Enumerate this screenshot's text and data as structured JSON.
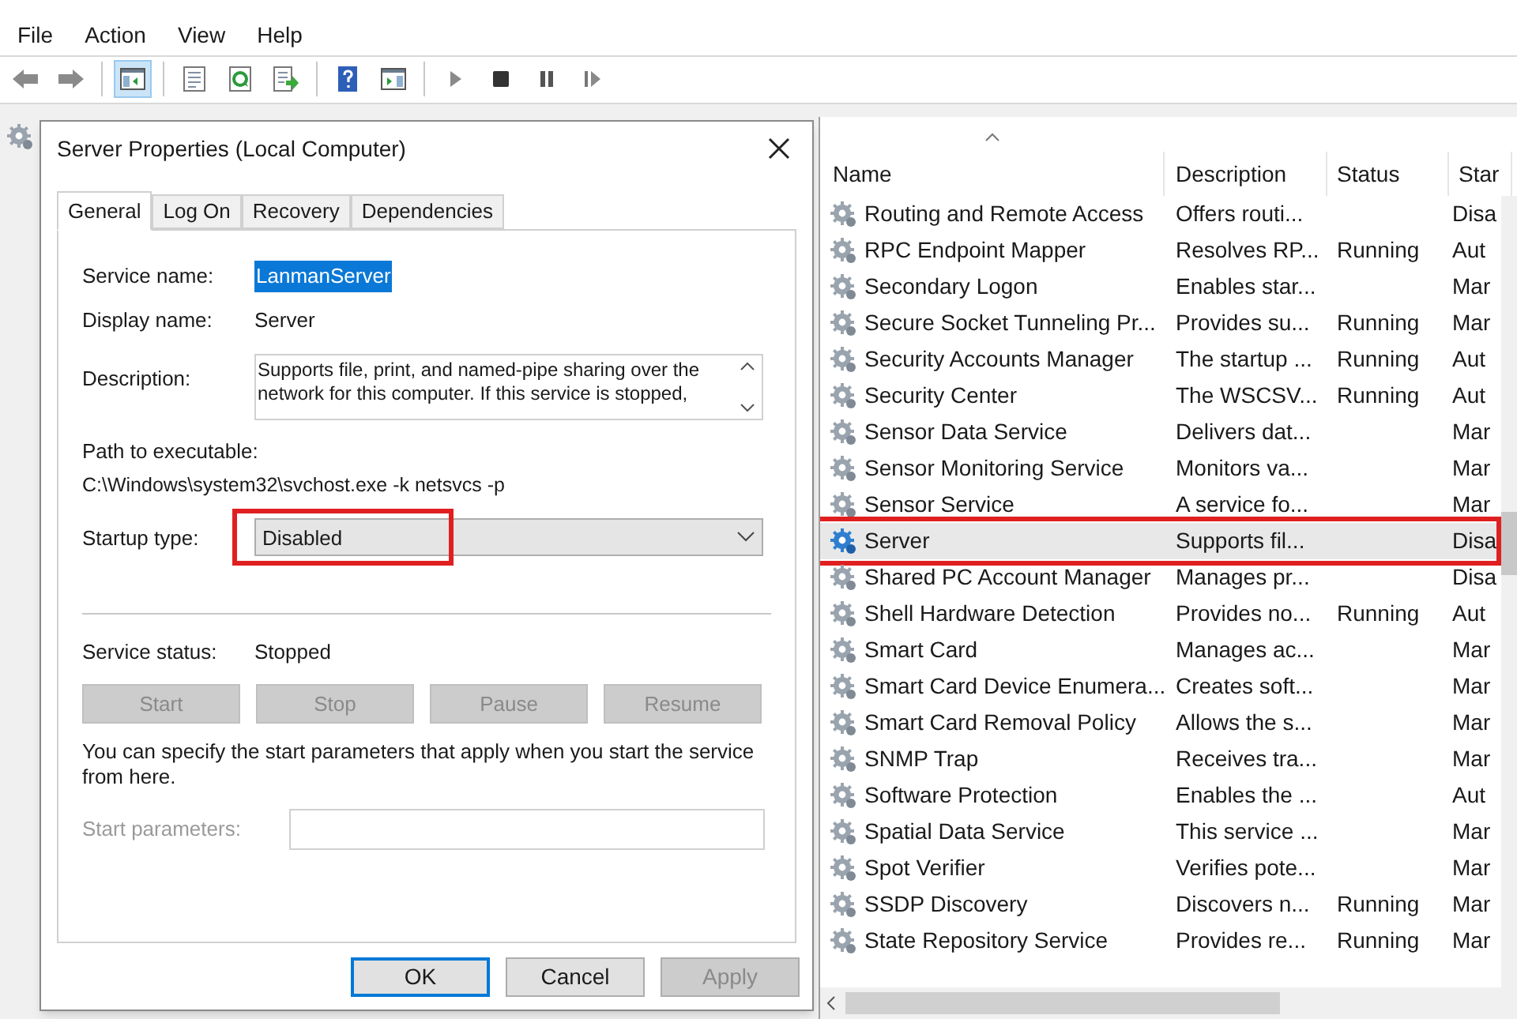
{
  "menu": [
    "File",
    "Action",
    "View",
    "Help"
  ],
  "toolbar": [
    {
      "kind": "back",
      "selected": false
    },
    {
      "kind": "forward",
      "selected": false
    },
    {
      "kind": "sep"
    },
    {
      "kind": "tree",
      "selected": true
    },
    {
      "kind": "sep"
    },
    {
      "kind": "properties",
      "selected": false
    },
    {
      "kind": "refresh",
      "selected": false
    },
    {
      "kind": "export",
      "selected": false
    },
    {
      "kind": "sep"
    },
    {
      "kind": "help",
      "selected": false
    },
    {
      "kind": "pane",
      "selected": false
    },
    {
      "kind": "sep"
    },
    {
      "kind": "play",
      "selected": false
    },
    {
      "kind": "stop",
      "selected": false
    },
    {
      "kind": "pause",
      "selected": false
    },
    {
      "kind": "resume",
      "selected": false
    }
  ],
  "dialog": {
    "title": "Server Properties (Local Computer)",
    "tabs": [
      {
        "label": "General",
        "selected": true
      },
      {
        "label": "Log On",
        "selected": false
      },
      {
        "label": "Recovery",
        "selected": false
      },
      {
        "label": "Dependencies",
        "selected": false
      }
    ],
    "service_name": {
      "label": "Service name:",
      "value": "LanmanServer"
    },
    "display_name": {
      "label": "Display name:",
      "value": "Server"
    },
    "description": {
      "label": "Description:",
      "value": "Supports file, print, and named-pipe sharing over the network for this computer. If this service is stopped,"
    },
    "path": {
      "label": "Path to executable:",
      "value": "C:\\Windows\\system32\\svchost.exe -k netsvcs -p"
    },
    "startup_type": {
      "label": "Startup type:",
      "value": "Disabled",
      "highlighted": true
    },
    "service_status": {
      "label": "Service status:",
      "value": "Stopped"
    },
    "control_buttons": [
      {
        "label": "Start",
        "disabled": true
      },
      {
        "label": "Stop",
        "disabled": true
      },
      {
        "label": "Pause",
        "disabled": true
      },
      {
        "label": "Resume",
        "disabled": true
      }
    ],
    "hint": "You can specify the start parameters that apply when you start the service from here.",
    "start_parameters": {
      "label": "Start parameters:",
      "disabled": true
    },
    "buttons": [
      {
        "label": "OK",
        "disabled": false,
        "default": true
      },
      {
        "label": "Cancel",
        "disabled": false,
        "default": false
      },
      {
        "label": "Apply",
        "disabled": true,
        "default": false
      }
    ]
  },
  "services": {
    "columns": [
      "Name",
      "Description",
      "Status",
      "Star"
    ],
    "rows": [
      {
        "name": "Routing and Remote Access",
        "description": "Offers routi...",
        "status": "",
        "startup": "Disa",
        "selected": false,
        "highlighted": false
      },
      {
        "name": "RPC Endpoint Mapper",
        "description": "Resolves RP...",
        "status": "Running",
        "startup": "Aut",
        "selected": false,
        "highlighted": false
      },
      {
        "name": "Secondary Logon",
        "description": "Enables star...",
        "status": "",
        "startup": "Mar",
        "selected": false,
        "highlighted": false
      },
      {
        "name": "Secure Socket Tunneling Pr...",
        "description": "Provides su...",
        "status": "Running",
        "startup": "Mar",
        "selected": false,
        "highlighted": false
      },
      {
        "name": "Security Accounts Manager",
        "description": "The startup ...",
        "status": "Running",
        "startup": "Aut",
        "selected": false,
        "highlighted": false
      },
      {
        "name": "Security Center",
        "description": "The WSCSV...",
        "status": "Running",
        "startup": "Aut",
        "selected": false,
        "highlighted": false
      },
      {
        "name": "Sensor Data Service",
        "description": "Delivers dat...",
        "status": "",
        "startup": "Mar",
        "selected": false,
        "highlighted": false
      },
      {
        "name": "Sensor Monitoring Service",
        "description": "Monitors va...",
        "status": "",
        "startup": "Mar",
        "selected": false,
        "highlighted": false
      },
      {
        "name": "Sensor Service",
        "description": "A service fo...",
        "status": "",
        "startup": "Mar",
        "selected": false,
        "highlighted": false
      },
      {
        "name": "Server",
        "description": "Supports fil...",
        "status": "",
        "startup": "Disa",
        "selected": true,
        "highlighted": true
      },
      {
        "name": "Shared PC Account Manager",
        "description": "Manages pr...",
        "status": "",
        "startup": "Disa",
        "selected": false,
        "highlighted": false
      },
      {
        "name": "Shell Hardware Detection",
        "description": "Provides no...",
        "status": "Running",
        "startup": "Aut",
        "selected": false,
        "highlighted": false
      },
      {
        "name": "Smart Card",
        "description": "Manages ac...",
        "status": "",
        "startup": "Mar",
        "selected": false,
        "highlighted": false
      },
      {
        "name": "Smart Card Device Enumera...",
        "description": "Creates soft...",
        "status": "",
        "startup": "Mar",
        "selected": false,
        "highlighted": false
      },
      {
        "name": "Smart Card Removal Policy",
        "description": "Allows the s...",
        "status": "",
        "startup": "Mar",
        "selected": false,
        "highlighted": false
      },
      {
        "name": "SNMP Trap",
        "description": "Receives tra...",
        "status": "",
        "startup": "Mar",
        "selected": false,
        "highlighted": false
      },
      {
        "name": "Software Protection",
        "description": "Enables the ...",
        "status": "",
        "startup": "Aut",
        "selected": false,
        "highlighted": false
      },
      {
        "name": "Spatial Data Service",
        "description": "This service ...",
        "status": "",
        "startup": "Mar",
        "selected": false,
        "highlighted": false
      },
      {
        "name": "Spot Verifier",
        "description": "Verifies pote...",
        "status": "",
        "startup": "Mar",
        "selected": false,
        "highlighted": false
      },
      {
        "name": "SSDP Discovery",
        "description": "Discovers n...",
        "status": "Running",
        "startup": "Mar",
        "selected": false,
        "highlighted": false
      },
      {
        "name": "State Repository Service",
        "description": "Provides re...",
        "status": "Running",
        "startup": "Mar",
        "selected": false,
        "highlighted": false
      }
    ]
  }
}
